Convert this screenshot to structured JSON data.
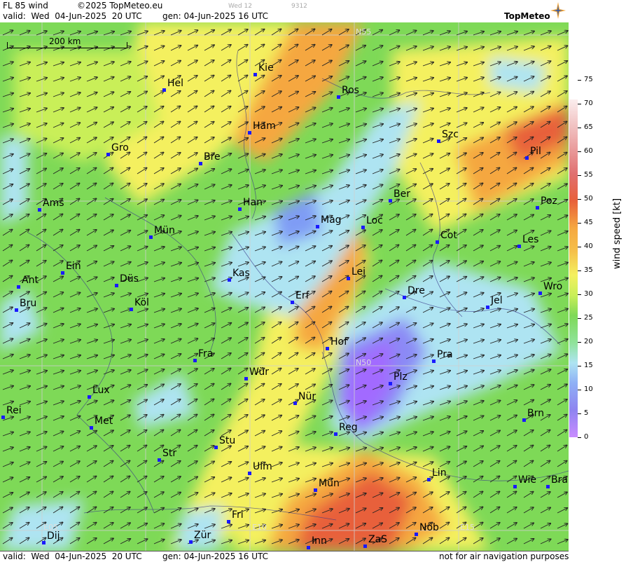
{
  "header": {
    "product": "FL 85 wind",
    "copyright": "©2025 TopMeteo.eu",
    "run_small": "Wed 12",
    "code_small": "9312",
    "valid": "valid:  Wed  04-Jun-2025  20 UTC",
    "gen": "gen: 04-Jun-2025 16 UTC",
    "logo": "TopMeteo"
  },
  "footer": {
    "valid": "valid:  Wed  04-Jun-2025  20 UTC",
    "gen": "gen: 04-Jun-2025 16 UTC",
    "disclaimer": "not for air navigation purposes"
  },
  "scale_label": "200 km",
  "legend": {
    "title": "wind speed [kt]",
    "ticks": [
      "0",
      "5",
      "10",
      "15",
      "20",
      "25",
      "30",
      "35",
      "40",
      "45",
      "50",
      "55",
      "60",
      "65",
      "70",
      "75"
    ]
  },
  "grid_labels": [
    "N55",
    "N50",
    "E05",
    "E10",
    "E15"
  ],
  "cities": [
    "Kie",
    "Hel",
    "Ros",
    "Ham",
    "Szc",
    "Gro",
    "Bre",
    "Pil",
    "Ber",
    "Ams",
    "Han",
    "Poz",
    "Mag",
    "Loc",
    "Cot",
    "Les",
    "Mün",
    "Ein",
    "Kas",
    "Lei",
    "Ant",
    "Düs",
    "Wro",
    "Dre",
    "Köl",
    "Bru",
    "Erf",
    "Jel",
    "Hof",
    "Pra",
    "Fra",
    "Wür",
    "Plz",
    "Lux",
    "Nür",
    "Rei",
    "Met",
    "Brn",
    "Reg",
    "Stu",
    "Str",
    "Lin",
    "Ulm",
    "Wie",
    "Bra",
    "Mün",
    "Fri",
    "Nöb",
    "Zür",
    "Dij",
    "Inn",
    "ZaS"
  ],
  "colors": {
    "calm_purple": "#a26bff",
    "light_blue": "#aee4f2",
    "green": "#7ed957",
    "yellow": "#f4f05e",
    "orange": "#f5a740",
    "red": "#e8603a",
    "marker": "#1a1aff"
  }
}
